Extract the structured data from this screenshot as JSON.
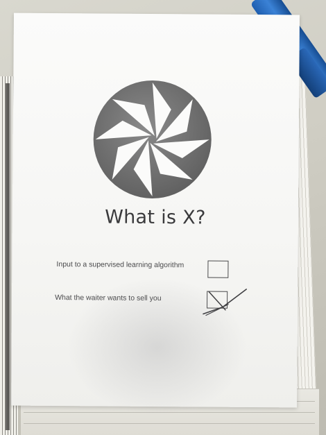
{
  "sheet": {
    "title": "What is X?",
    "options": [
      {
        "label": "Input to a supervised learning algorithm",
        "checked": false
      },
      {
        "label": "What the waiter wants to sell you",
        "checked": true
      }
    ]
  },
  "colors": {
    "logo_fill": "#707070",
    "ink": "#3a3a3c",
    "pen": "#2f73c6"
  },
  "icons": {
    "logo": "pinwheel-logo-icon",
    "check_mark": "check-mark-icon"
  }
}
